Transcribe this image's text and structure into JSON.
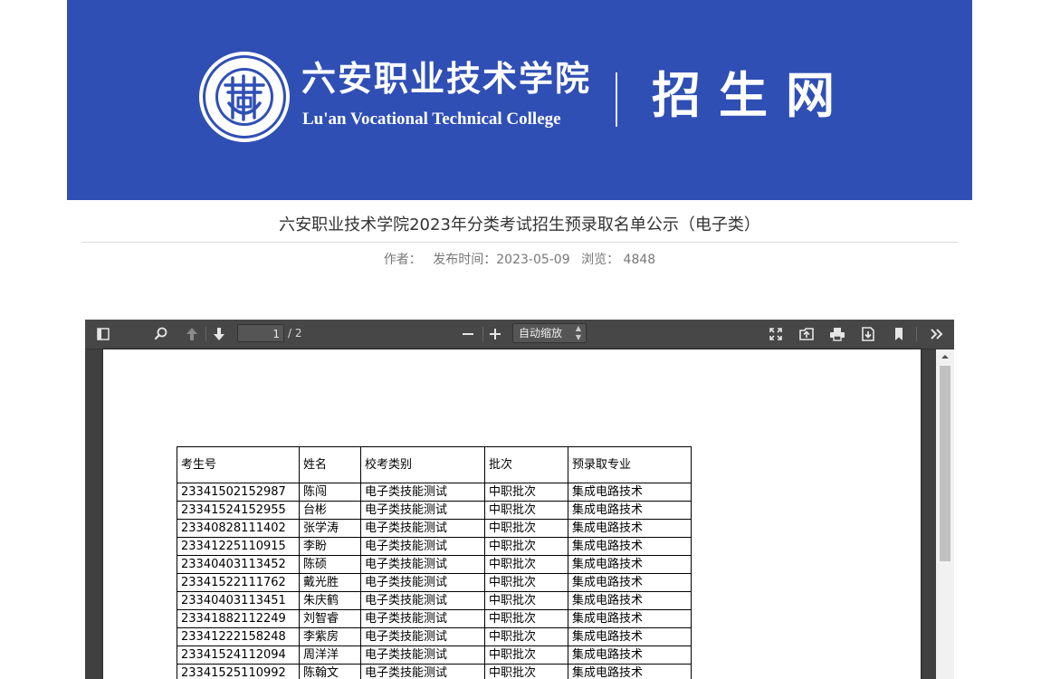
{
  "banner": {
    "school_cn": "六安职业技术学院",
    "school_en": "Lu'an Vocational  Technical College",
    "site_name": "招生网"
  },
  "article": {
    "title": "六安职业技术学院2023年分类考试招生预录取名单公示（电子类）",
    "author_label": "作者：",
    "publish_label": "发布时间：2023-05-09",
    "views_label": "浏览：",
    "views": "4848"
  },
  "pdf_viewer": {
    "current_page": "1",
    "total_pages": "/ 2",
    "zoom": "自动缩放"
  },
  "table": {
    "headers": [
      "考生号",
      "姓名",
      "校考类别",
      "批次",
      "预录取专业"
    ],
    "rows": [
      [
        "23341502152987",
        "陈闯",
        "电子类技能测试",
        "中职批次",
        "集成电路技术"
      ],
      [
        "23341524152955",
        "台彬",
        "电子类技能测试",
        "中职批次",
        "集成电路技术"
      ],
      [
        "23340828111402",
        "张学涛",
        "电子类技能测试",
        "中职批次",
        "集成电路技术"
      ],
      [
        "23341225110915",
        "李盼",
        "电子类技能测试",
        "中职批次",
        "集成电路技术"
      ],
      [
        "23340403113452",
        "陈硕",
        "电子类技能测试",
        "中职批次",
        "集成电路技术"
      ],
      [
        "23341522111762",
        "戴光胜",
        "电子类技能测试",
        "中职批次",
        "集成电路技术"
      ],
      [
        "23340403113451",
        "朱庆鹤",
        "电子类技能测试",
        "中职批次",
        "集成电路技术"
      ],
      [
        "23341882112249",
        "刘智睿",
        "电子类技能测试",
        "中职批次",
        "集成电路技术"
      ],
      [
        "23341222158248",
        "李紫房",
        "电子类技能测试",
        "中职批次",
        "集成电路技术"
      ],
      [
        "23341524112094",
        "周洋洋",
        "电子类技能测试",
        "中职批次",
        "集成电路技术"
      ],
      [
        "23341525110992",
        "陈翰文",
        "电子类技能测试",
        "中职批次",
        "集成电路技术"
      ]
    ]
  },
  "colors": {
    "banner_blue": "#2f4fb5",
    "viewer_bg": "#404040",
    "toolbar_bg": "#474747"
  },
  "icons": [
    "menu-icon",
    "search-icon",
    "sidebar-toggle-icon",
    "find-icon",
    "previous-page-icon",
    "next-page-icon",
    "zoom-out-icon",
    "zoom-in-icon",
    "presentation-mode-icon",
    "open-file-icon",
    "print-icon",
    "download-icon",
    "bookmark-icon",
    "tools-icon"
  ]
}
